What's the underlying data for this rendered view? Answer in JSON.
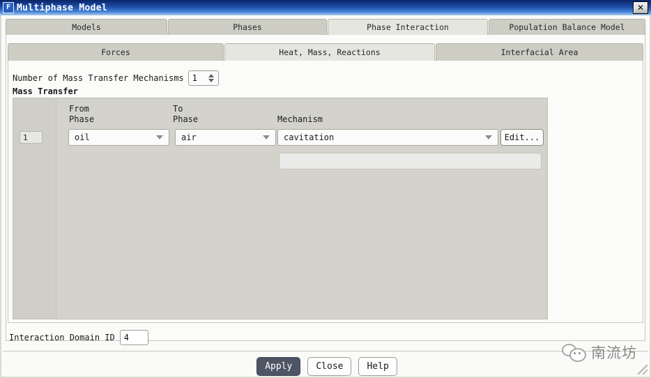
{
  "window": {
    "title": "Multiphase Model",
    "icon_label": "F",
    "close_label": "✕"
  },
  "outer_tabs": [
    {
      "label": "Models",
      "selected": false
    },
    {
      "label": "Phases",
      "selected": false
    },
    {
      "label": "Phase Interaction",
      "selected": true
    },
    {
      "label": "Population Balance Model",
      "selected": false
    }
  ],
  "inner_tabs": [
    {
      "label": "Forces",
      "selected": false
    },
    {
      "label": "Heat, Mass, Reactions",
      "selected": true
    },
    {
      "label": "Interfacial Area",
      "selected": false
    }
  ],
  "mechanisms": {
    "count_label": "Number of Mass Transfer Mechanisms",
    "count_value": "1",
    "group_label": "Mass Transfer",
    "headers": {
      "index": "",
      "from_phase": "From\nPhase",
      "to_phase": "To\nPhase",
      "mechanism": "Mechanism"
    },
    "rows": [
      {
        "index": "1",
        "from_phase": "oil",
        "to_phase": "air",
        "mechanism": "cavitation",
        "edit_label": "Edit...",
        "detail_value": ""
      }
    ]
  },
  "domain": {
    "label": "Interaction Domain ID",
    "value": "4"
  },
  "footer": {
    "apply": "Apply",
    "close": "Close",
    "help": "Help"
  },
  "watermark": {
    "text": "南流坊"
  }
}
